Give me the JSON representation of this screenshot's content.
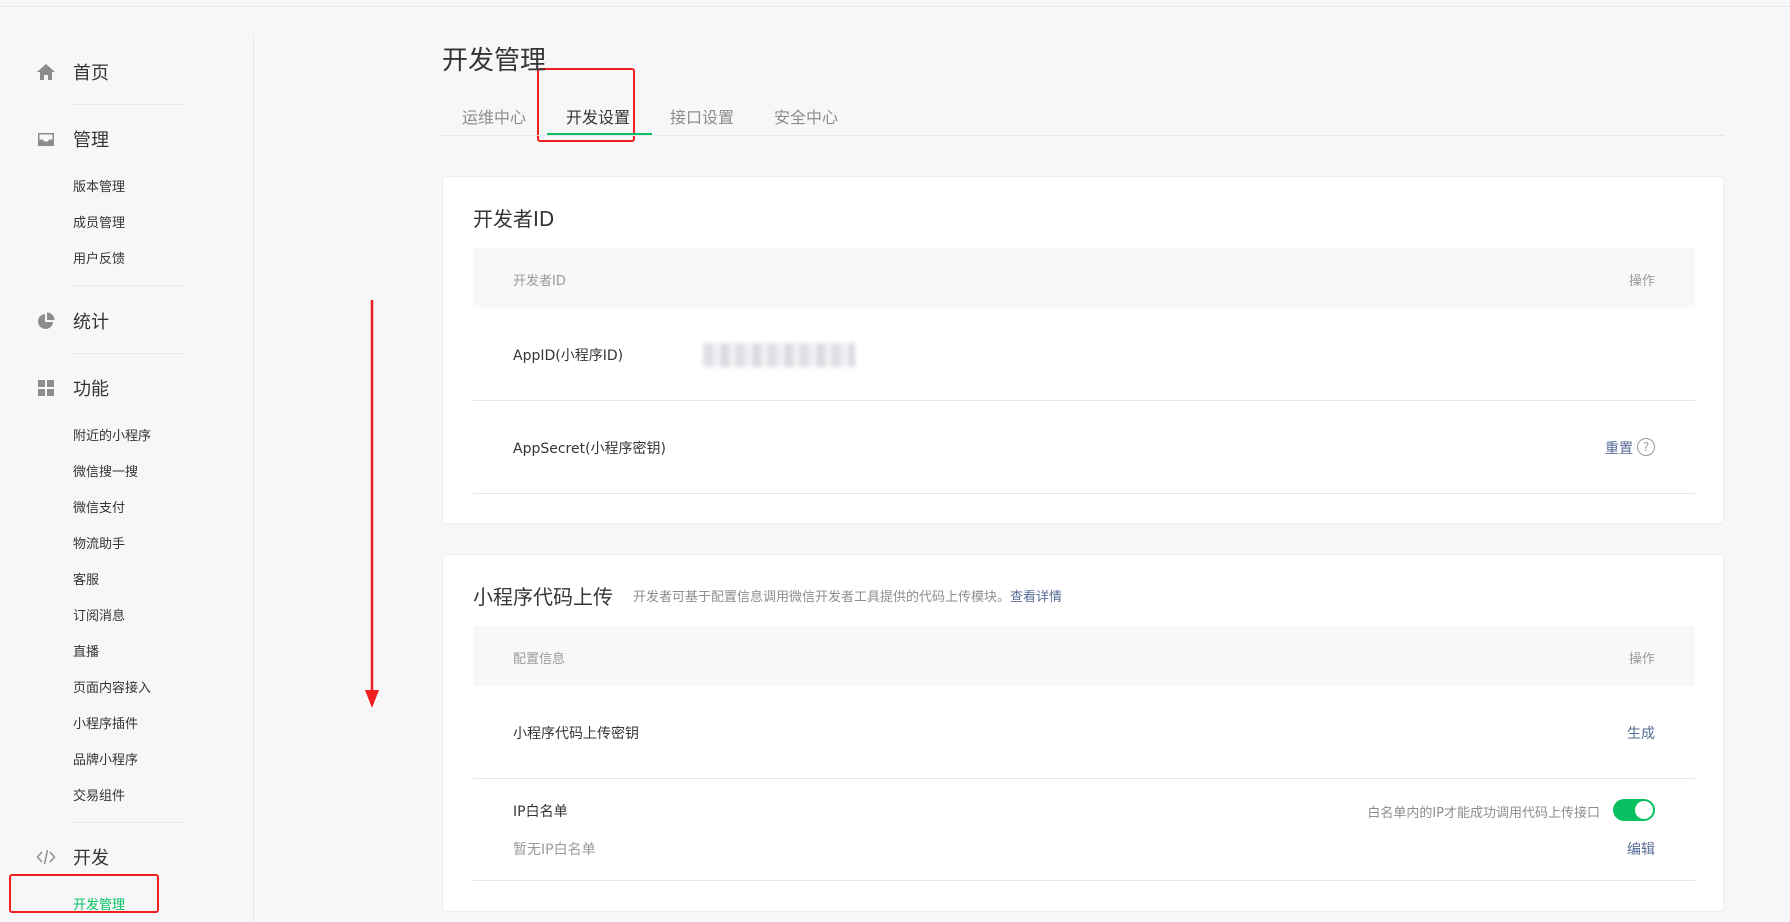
{
  "sidebar": {
    "home": {
      "label": "首页"
    },
    "manage": {
      "label": "管理",
      "items": [
        "版本管理",
        "成员管理",
        "用户反馈"
      ]
    },
    "stats": {
      "label": "统计"
    },
    "features": {
      "label": "功能",
      "items": [
        "附近的小程序",
        "微信搜一搜",
        "微信支付",
        "物流助手",
        "客服",
        "订阅消息",
        "直播",
        "页面内容接入",
        "小程序插件",
        "品牌小程序",
        "交易组件"
      ]
    },
    "dev": {
      "label": "开发",
      "items": [
        "开发管理"
      ]
    }
  },
  "main": {
    "title": "开发管理",
    "tabs": [
      "运维中心",
      "开发设置",
      "接口设置",
      "安全中心"
    ],
    "active_tab": 1
  },
  "dev_id_card": {
    "title": "开发者ID",
    "header": {
      "col1": "开发者ID",
      "col2": "操作"
    },
    "rows": [
      {
        "label": "AppID(小程序ID)"
      },
      {
        "label": "AppSecret(小程序密钥)",
        "action": "重置",
        "help": "?"
      }
    ]
  },
  "upload_card": {
    "title": "小程序代码上传",
    "desc": "开发者可基于配置信息调用微信开发者工具提供的代码上传模块。",
    "desc_link": "查看详情",
    "header": {
      "col1": "配置信息",
      "col2": "操作"
    },
    "rows": [
      {
        "label": "小程序代码上传密钥",
        "action": "生成"
      },
      {
        "label": "IP白名单",
        "sub": "暂无IP白名单",
        "hint": "白名单内的IP才能成功调用代码上传接口",
        "action": "编辑",
        "toggle_on": true
      }
    ]
  },
  "colors": {
    "accent": "#07c160",
    "link": "#576b95",
    "annotation": "#f02020"
  }
}
